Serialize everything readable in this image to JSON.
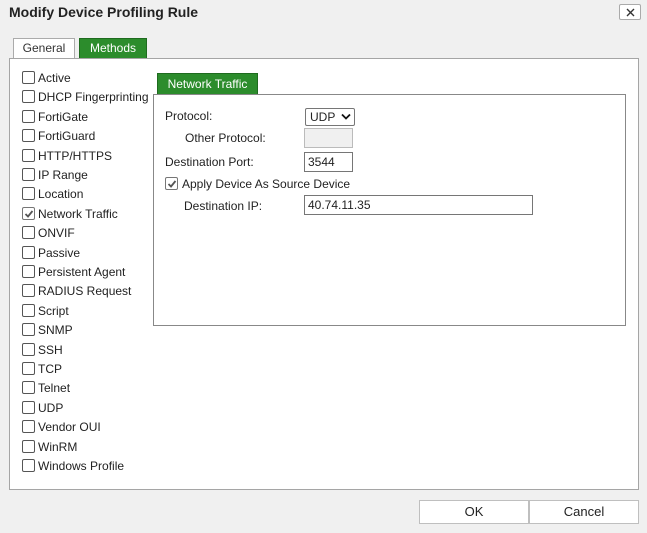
{
  "dialog": {
    "title": "Modify Device Profiling Rule"
  },
  "tabs": [
    {
      "label": "General",
      "active": false
    },
    {
      "label": "Methods",
      "active": true
    }
  ],
  "methods": [
    {
      "label": "Active",
      "checked": false
    },
    {
      "label": "DHCP Fingerprinting",
      "checked": false
    },
    {
      "label": "FortiGate",
      "checked": false
    },
    {
      "label": "FortiGuard",
      "checked": false
    },
    {
      "label": "HTTP/HTTPS",
      "checked": false
    },
    {
      "label": "IP Range",
      "checked": false
    },
    {
      "label": "Location",
      "checked": false
    },
    {
      "label": "Network Traffic",
      "checked": true
    },
    {
      "label": "ONVIF",
      "checked": false
    },
    {
      "label": "Passive",
      "checked": false
    },
    {
      "label": "Persistent Agent",
      "checked": false
    },
    {
      "label": "RADIUS Request",
      "checked": false
    },
    {
      "label": "Script",
      "checked": false
    },
    {
      "label": "SNMP",
      "checked": false
    },
    {
      "label": "SSH",
      "checked": false
    },
    {
      "label": "TCP",
      "checked": false
    },
    {
      "label": "Telnet",
      "checked": false
    },
    {
      "label": "UDP",
      "checked": false
    },
    {
      "label": "Vendor OUI",
      "checked": false
    },
    {
      "label": "WinRM",
      "checked": false
    },
    {
      "label": "Windows Profile",
      "checked": false
    }
  ],
  "network_traffic": {
    "tab_label": "Network Traffic",
    "protocol_label": "Protocol:",
    "protocol_value": "UDP",
    "other_protocol_label": "Other Protocol:",
    "other_protocol_value": "",
    "destination_port_label": "Destination Port:",
    "destination_port_value": "3544",
    "apply_source_label": "Apply Device As Source Device",
    "apply_source_checked": true,
    "destination_ip_label": "Destination IP:",
    "destination_ip_value": "40.74.11.35"
  },
  "footer": {
    "ok_label": "OK",
    "cancel_label": "Cancel"
  }
}
